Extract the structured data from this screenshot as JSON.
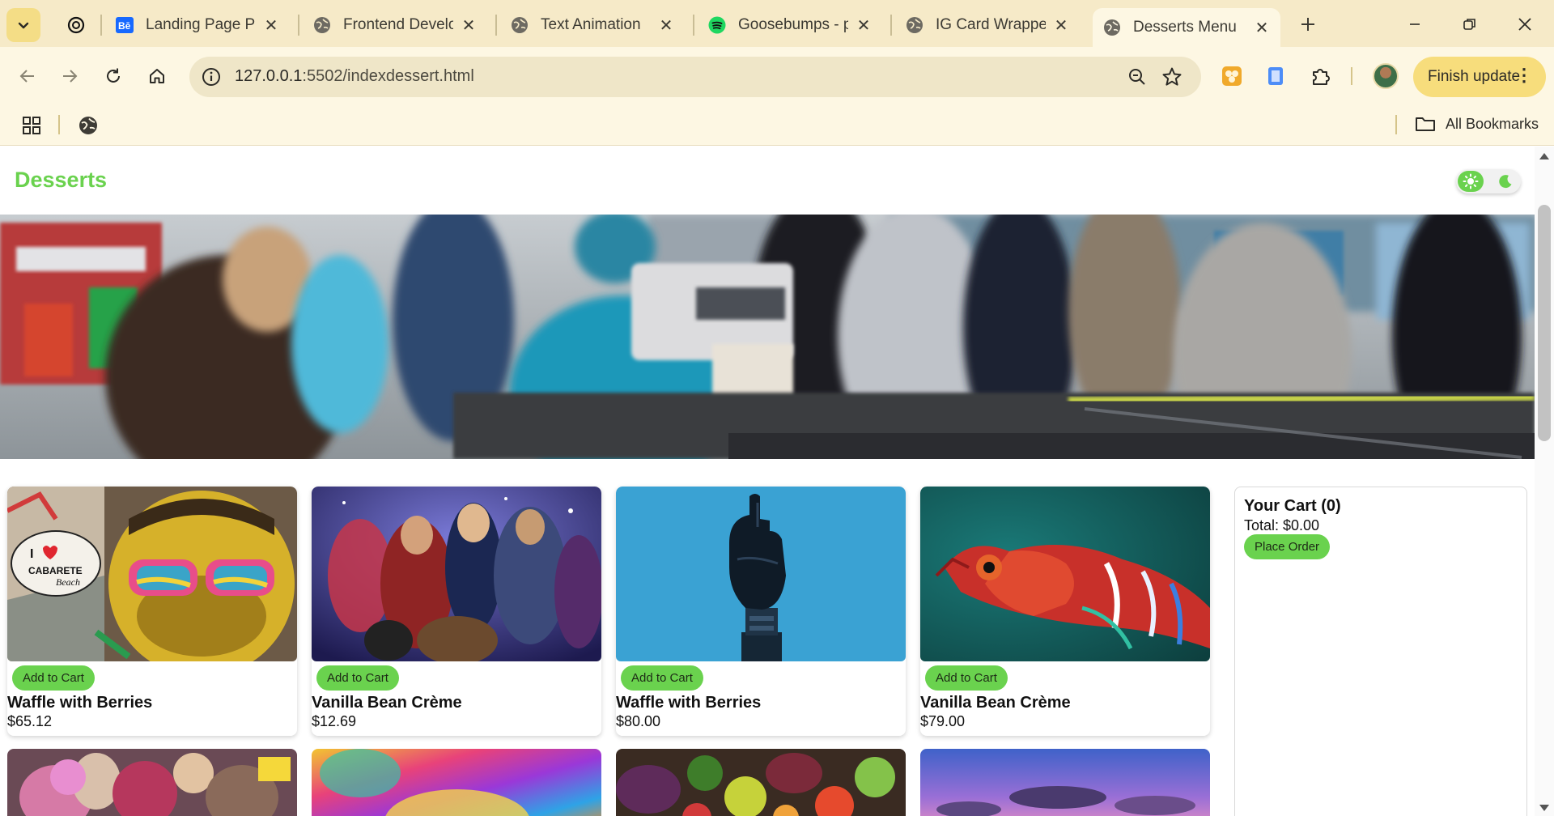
{
  "browser": {
    "tabs": [
      {
        "title": "Landing Page Por",
        "icon": "behance-icon"
      },
      {
        "title": "Frontend Develop",
        "icon": "globe-icon"
      },
      {
        "title": "Text Animation",
        "icon": "globe-icon"
      },
      {
        "title": "Goosebumps - pl",
        "icon": "spotify-icon"
      },
      {
        "title": "IG Card Wrapper",
        "icon": "globe-icon"
      },
      {
        "title": "Desserts Menu",
        "icon": "globe-icon",
        "active": true
      }
    ],
    "url_host": "127.0.0.1",
    "url_rest": ":5502/indexdessert.html",
    "update_label": "Finish update",
    "bookmarks_label": "All Bookmarks",
    "colors": {
      "accent": "#6ad24e",
      "chrome": "#f6eac8",
      "toolbar": "#fdf7e3"
    }
  },
  "page": {
    "title": "Desserts",
    "theme_toggle": {
      "state": "light"
    },
    "products": [
      {
        "name": "Waffle with Berries",
        "price": "$65.12",
        "button": "Add to Cart",
        "image": "graffiti-monkey-sunglasses"
      },
      {
        "name": "Vanilla Bean Crème",
        "price": "$12.69",
        "button": "Add to Cart",
        "image": "superhero-group"
      },
      {
        "name": "Waffle with Berries",
        "price": "$80.00",
        "button": "Add to Cart",
        "image": "robot-hand-blue"
      },
      {
        "name": "Vanilla Bean Crème",
        "price": "$79.00",
        "button": "Add to Cart",
        "image": "chameleon"
      }
    ],
    "cart": {
      "title": "Your Cart (0)",
      "total": "Total: $0.00",
      "order_button": "Place Order"
    }
  }
}
